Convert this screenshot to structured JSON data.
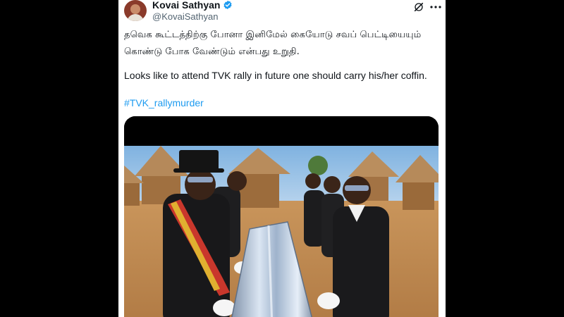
{
  "author": {
    "name": "Kovai Sathyan",
    "handle": "@KovaiSathyan",
    "verified": true
  },
  "post": {
    "text_tamil": "தவெக கூட்டத்திற்கு போனா இனிமேல் கையோடு சவப் பெட்டியையும் கொண்டு போக வேண்டும் என்பது உறுதி.",
    "text_english": "Looks like to attend TVK rally in future  one should carry his/her coffin.",
    "hashtag": "#TVK_rallymurder"
  },
  "icons": {
    "grok": "grok-icon",
    "more": "more-options-icon",
    "verified": "verified-badge-icon"
  },
  "colors": {
    "link": "#1d9bf0",
    "verified": "#1d9bf0",
    "text": "#0f1419",
    "secondary": "#536471"
  }
}
